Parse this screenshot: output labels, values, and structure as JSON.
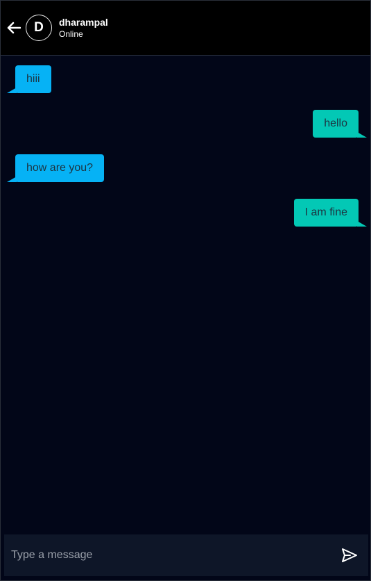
{
  "header": {
    "avatar_letter": "D",
    "name": "dharampal",
    "status": "Online"
  },
  "messages": [
    {
      "text": "hiii",
      "direction": "incoming"
    },
    {
      "text": "hello",
      "direction": "outgoing"
    },
    {
      "text": "how are you?",
      "direction": "incoming"
    },
    {
      "text": "I am fine",
      "direction": "outgoing"
    }
  ],
  "composer": {
    "placeholder": "Type a message",
    "value": ""
  },
  "colors": {
    "incoming_bubble": "#06b2f5",
    "outgoing_bubble": "#03c8b5",
    "background": "#020618",
    "header": "#000000",
    "composer": "#0e1628"
  },
  "icons": {
    "back": "arrow-left-icon",
    "send": "send-icon"
  }
}
